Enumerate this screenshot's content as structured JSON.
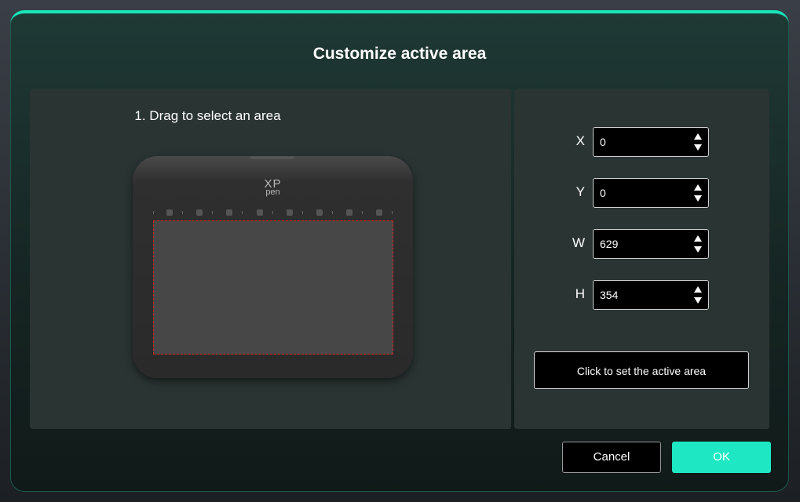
{
  "dialog": {
    "title": "Customize active area"
  },
  "left_panel": {
    "instruction": "1. Drag to select an area",
    "tablet": {
      "logo_top": "XP",
      "logo_bottom": "pen",
      "express_keys": 8
    }
  },
  "right_panel": {
    "fields": [
      {
        "label": "X",
        "value": "0"
      },
      {
        "label": "Y",
        "value": "0"
      },
      {
        "label": "W",
        "value": "629"
      },
      {
        "label": "H",
        "value": "354"
      }
    ],
    "set_area_label": "Click to set the active area"
  },
  "footer": {
    "cancel_label": "Cancel",
    "ok_label": "OK"
  },
  "colors": {
    "accent": "#1ee8c4",
    "selection_border": "#d92020"
  }
}
